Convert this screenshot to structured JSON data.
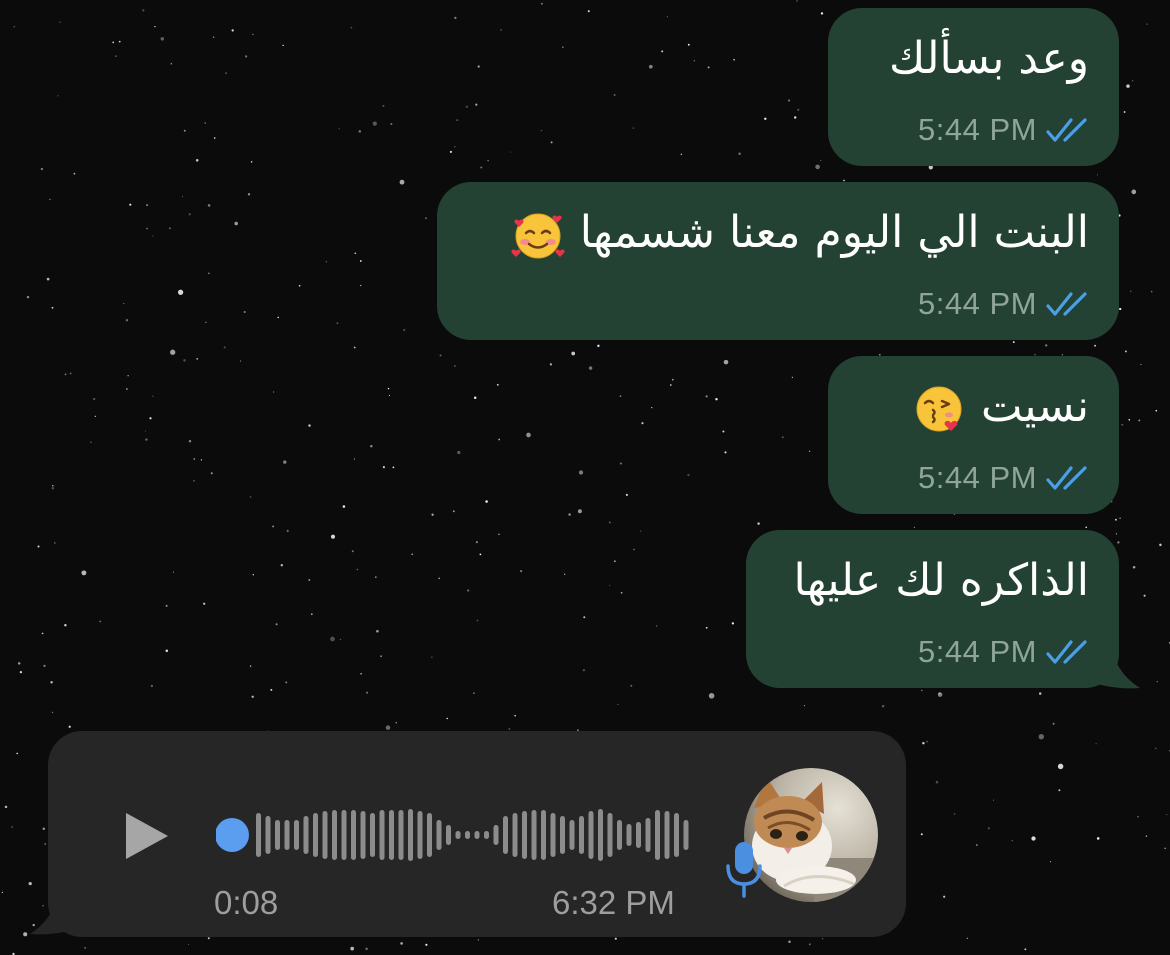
{
  "chat": {
    "messages": [
      {
        "text": "وعد بسألك",
        "time": "5:44 PM",
        "status_icon": "double-check-icon",
        "emoji": ""
      },
      {
        "text": "البنت الي اليوم معنا شسمها",
        "time": "5:44 PM",
        "status_icon": "double-check-icon",
        "emoji": "smiling-face-with-hearts-emoji"
      },
      {
        "text": "نسيت",
        "time": "5:44 PM",
        "status_icon": "double-check-icon",
        "emoji": "face-blowing-kiss-emoji"
      },
      {
        "text": "الذاكره لك عليها",
        "time": "5:44 PM",
        "status_icon": "double-check-icon",
        "emoji": ""
      }
    ],
    "voice_message": {
      "duration": "0:08",
      "time": "6:32 PM",
      "play_icon": "play-icon",
      "mic_icon": "microphone-icon",
      "avatar": "cat-avatar",
      "progress": 0
    }
  },
  "colors": {
    "outgoing_bubble": "#234233",
    "incoming_bubble": "#262626",
    "read_check": "#4a9fe6",
    "accent_blue": "#5b9ef0",
    "meta_text": "#8ea598"
  }
}
